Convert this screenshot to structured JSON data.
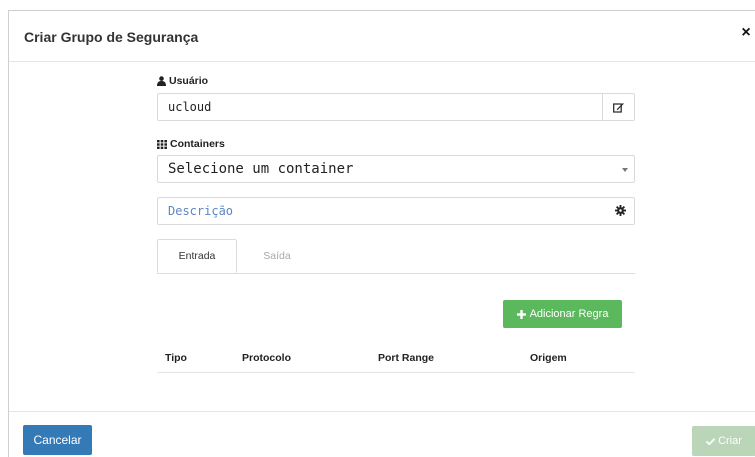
{
  "modal": {
    "title": "Criar Grupo de Segurança",
    "close": "×"
  },
  "user": {
    "label": "Usuário",
    "value": "ucloud",
    "icon": "user-icon",
    "edit_icon": "edit-icon"
  },
  "containers": {
    "label": "Containers",
    "icon": "grid-icon",
    "selected": "Selecione um container"
  },
  "description": {
    "placeholder": "Descrição",
    "icon": "gear-icon"
  },
  "tabs": [
    {
      "label": "Entrada",
      "active": true
    },
    {
      "label": "Saída",
      "active": false
    }
  ],
  "add_rule_label": "Adicionar Regra",
  "table": {
    "headers": [
      "Tipo",
      "Protocolo",
      "Port Range",
      "Origem"
    ]
  },
  "footer": {
    "cancel_label": "Cancelar",
    "create_label": "Criar"
  },
  "colors": {
    "primary": "#337ab7",
    "success": "#5cb85c",
    "disabled_success": "#b3d1b1",
    "placeholder_text": "#5b87c4"
  }
}
